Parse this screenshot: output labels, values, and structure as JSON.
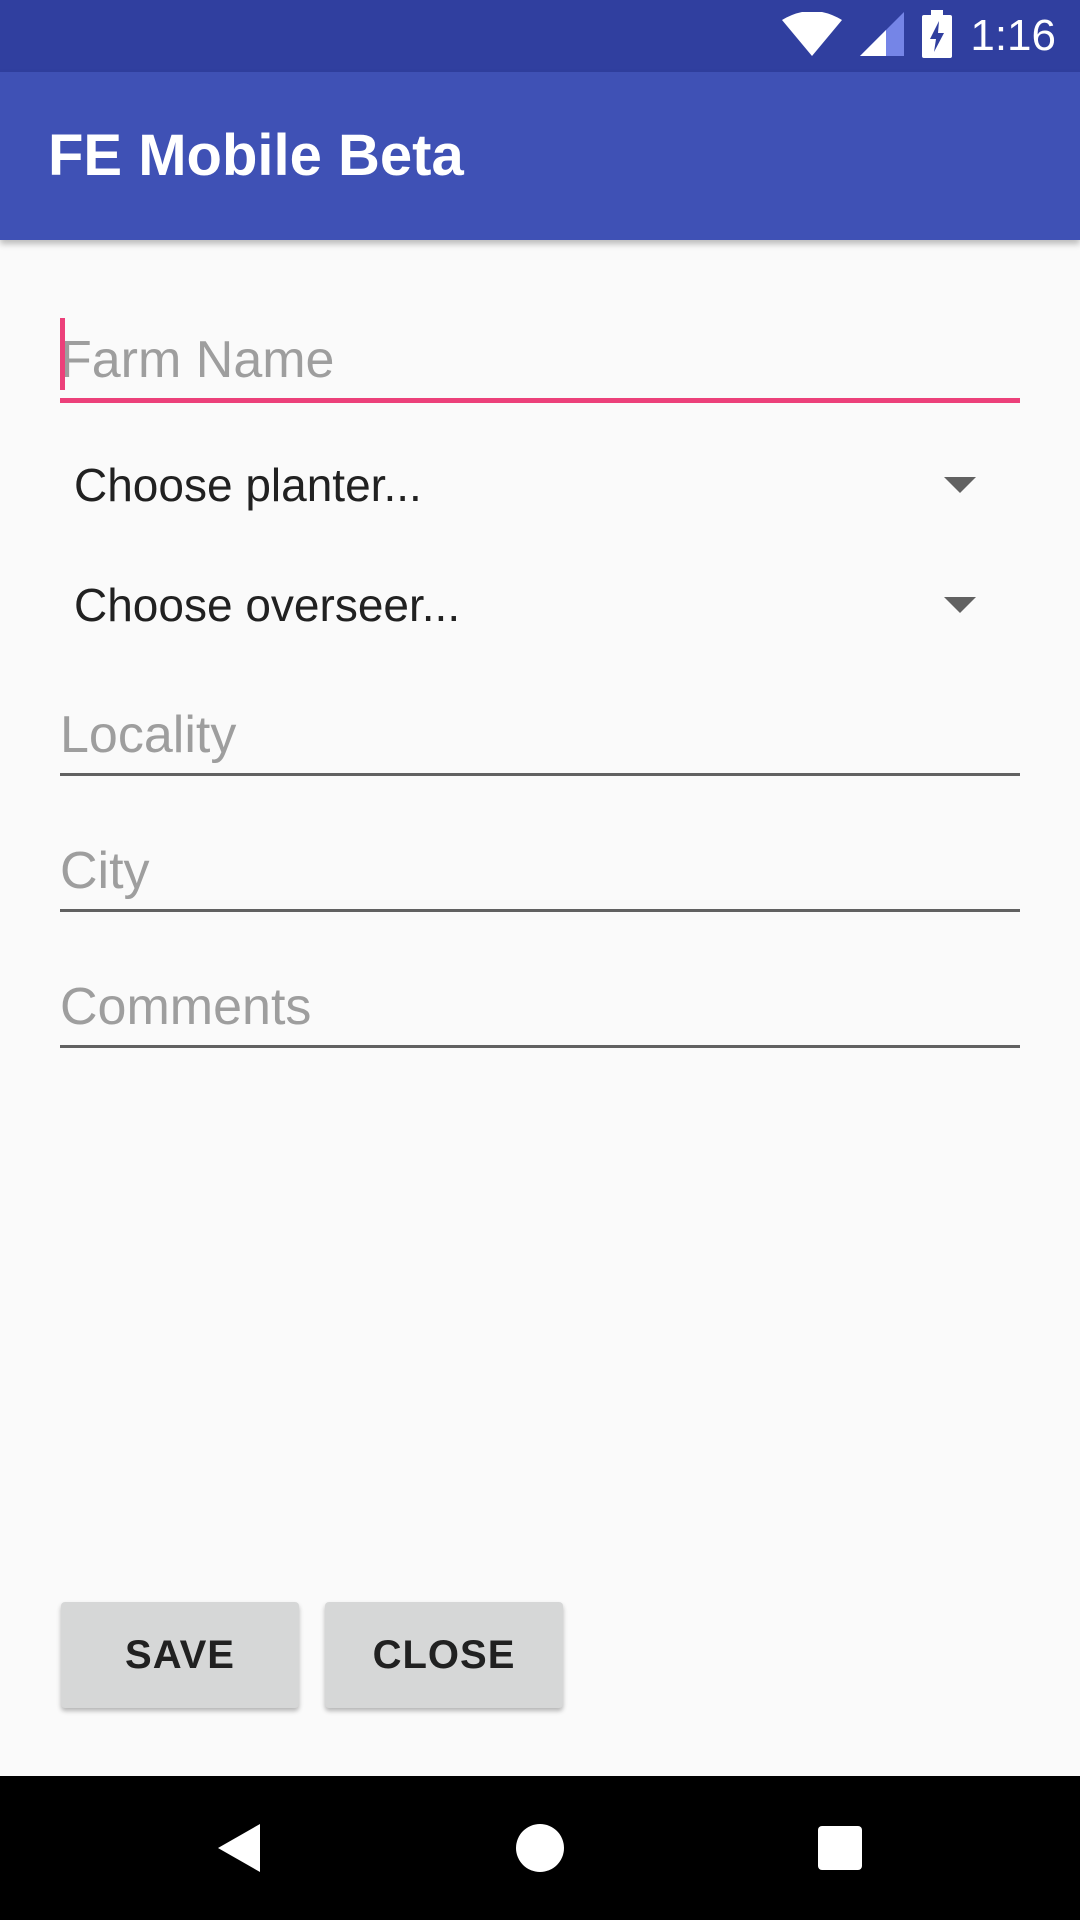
{
  "status_bar": {
    "time": "1:16",
    "icons": [
      "wifi-icon",
      "cell-signal-icon",
      "battery-charging-icon"
    ],
    "background": "#303f9f"
  },
  "app_bar": {
    "title": "FE Mobile Beta",
    "background": "#3f51b5"
  },
  "form": {
    "farm_name_placeholder": "Farm Name",
    "planter_selected": "Choose planter...",
    "overseer_selected": "Choose overseer...",
    "locality_placeholder": "Locality",
    "city_placeholder": "City",
    "comments_placeholder": "Comments",
    "accent_color": "#ec407a"
  },
  "buttons": {
    "save_label": "SAVE",
    "close_label": "CLOSE"
  },
  "nav_bar": {
    "icons": [
      "back-icon",
      "home-icon",
      "recents-icon"
    ]
  }
}
